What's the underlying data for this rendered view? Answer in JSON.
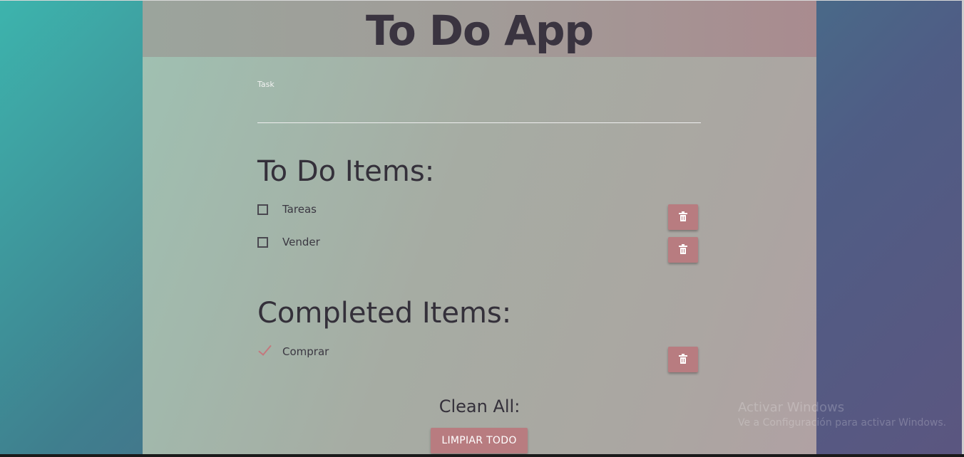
{
  "header": {
    "title": "To Do App"
  },
  "task_input": {
    "label": "Task",
    "value": "",
    "placeholder": ""
  },
  "todo_section": {
    "title": "To Do Items:",
    "items": [
      {
        "label": "Tareas",
        "checked": false
      },
      {
        "label": "Vender",
        "checked": false
      }
    ]
  },
  "completed_section": {
    "title": "Completed Items:",
    "items": [
      {
        "label": "Comprar",
        "checked": true
      }
    ]
  },
  "clean": {
    "label": "Clean All:",
    "button_label": "LIMPIAR TODO"
  },
  "watermark": {
    "title": "Activar Windows",
    "subtitle": "Ve a Configuración para activar Windows."
  },
  "colors": {
    "accent": "#b87c80",
    "text_dark": "#34303a",
    "background_start": "#3db4ad",
    "background_end": "#5b5680"
  },
  "icons": {
    "delete": "trash-icon",
    "done": "checkmark-icon"
  }
}
